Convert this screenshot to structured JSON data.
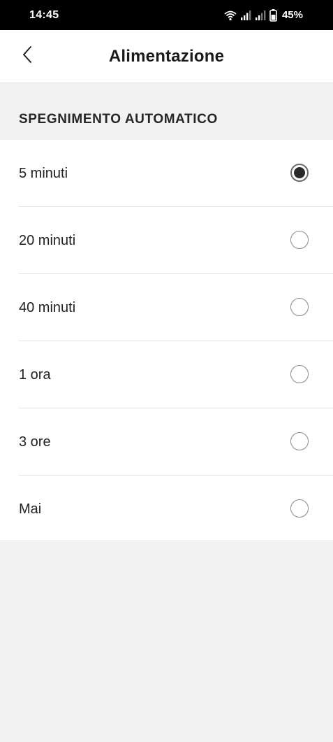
{
  "status_bar": {
    "time": "14:45",
    "battery_percent": "45%",
    "icons": [
      "wifi-icon",
      "signal-icon",
      "signal-icon",
      "battery-icon"
    ]
  },
  "header": {
    "back_icon": "chevron-left-icon",
    "title": "Alimentazione"
  },
  "section": {
    "title": "SPEGNIMENTO AUTOMATICO"
  },
  "options": [
    {
      "label": "5 minuti",
      "selected": true
    },
    {
      "label": "20 minuti",
      "selected": false
    },
    {
      "label": "40 minuti",
      "selected": false
    },
    {
      "label": "1 ora",
      "selected": false
    },
    {
      "label": "3 ore",
      "selected": false
    },
    {
      "label": "Mai",
      "selected": false
    }
  ],
  "colors": {
    "status_bar_bg": "#000000",
    "page_bg": "#f2f2f2",
    "card_bg": "#ffffff",
    "radio_selected": "#2a2a2a"
  }
}
